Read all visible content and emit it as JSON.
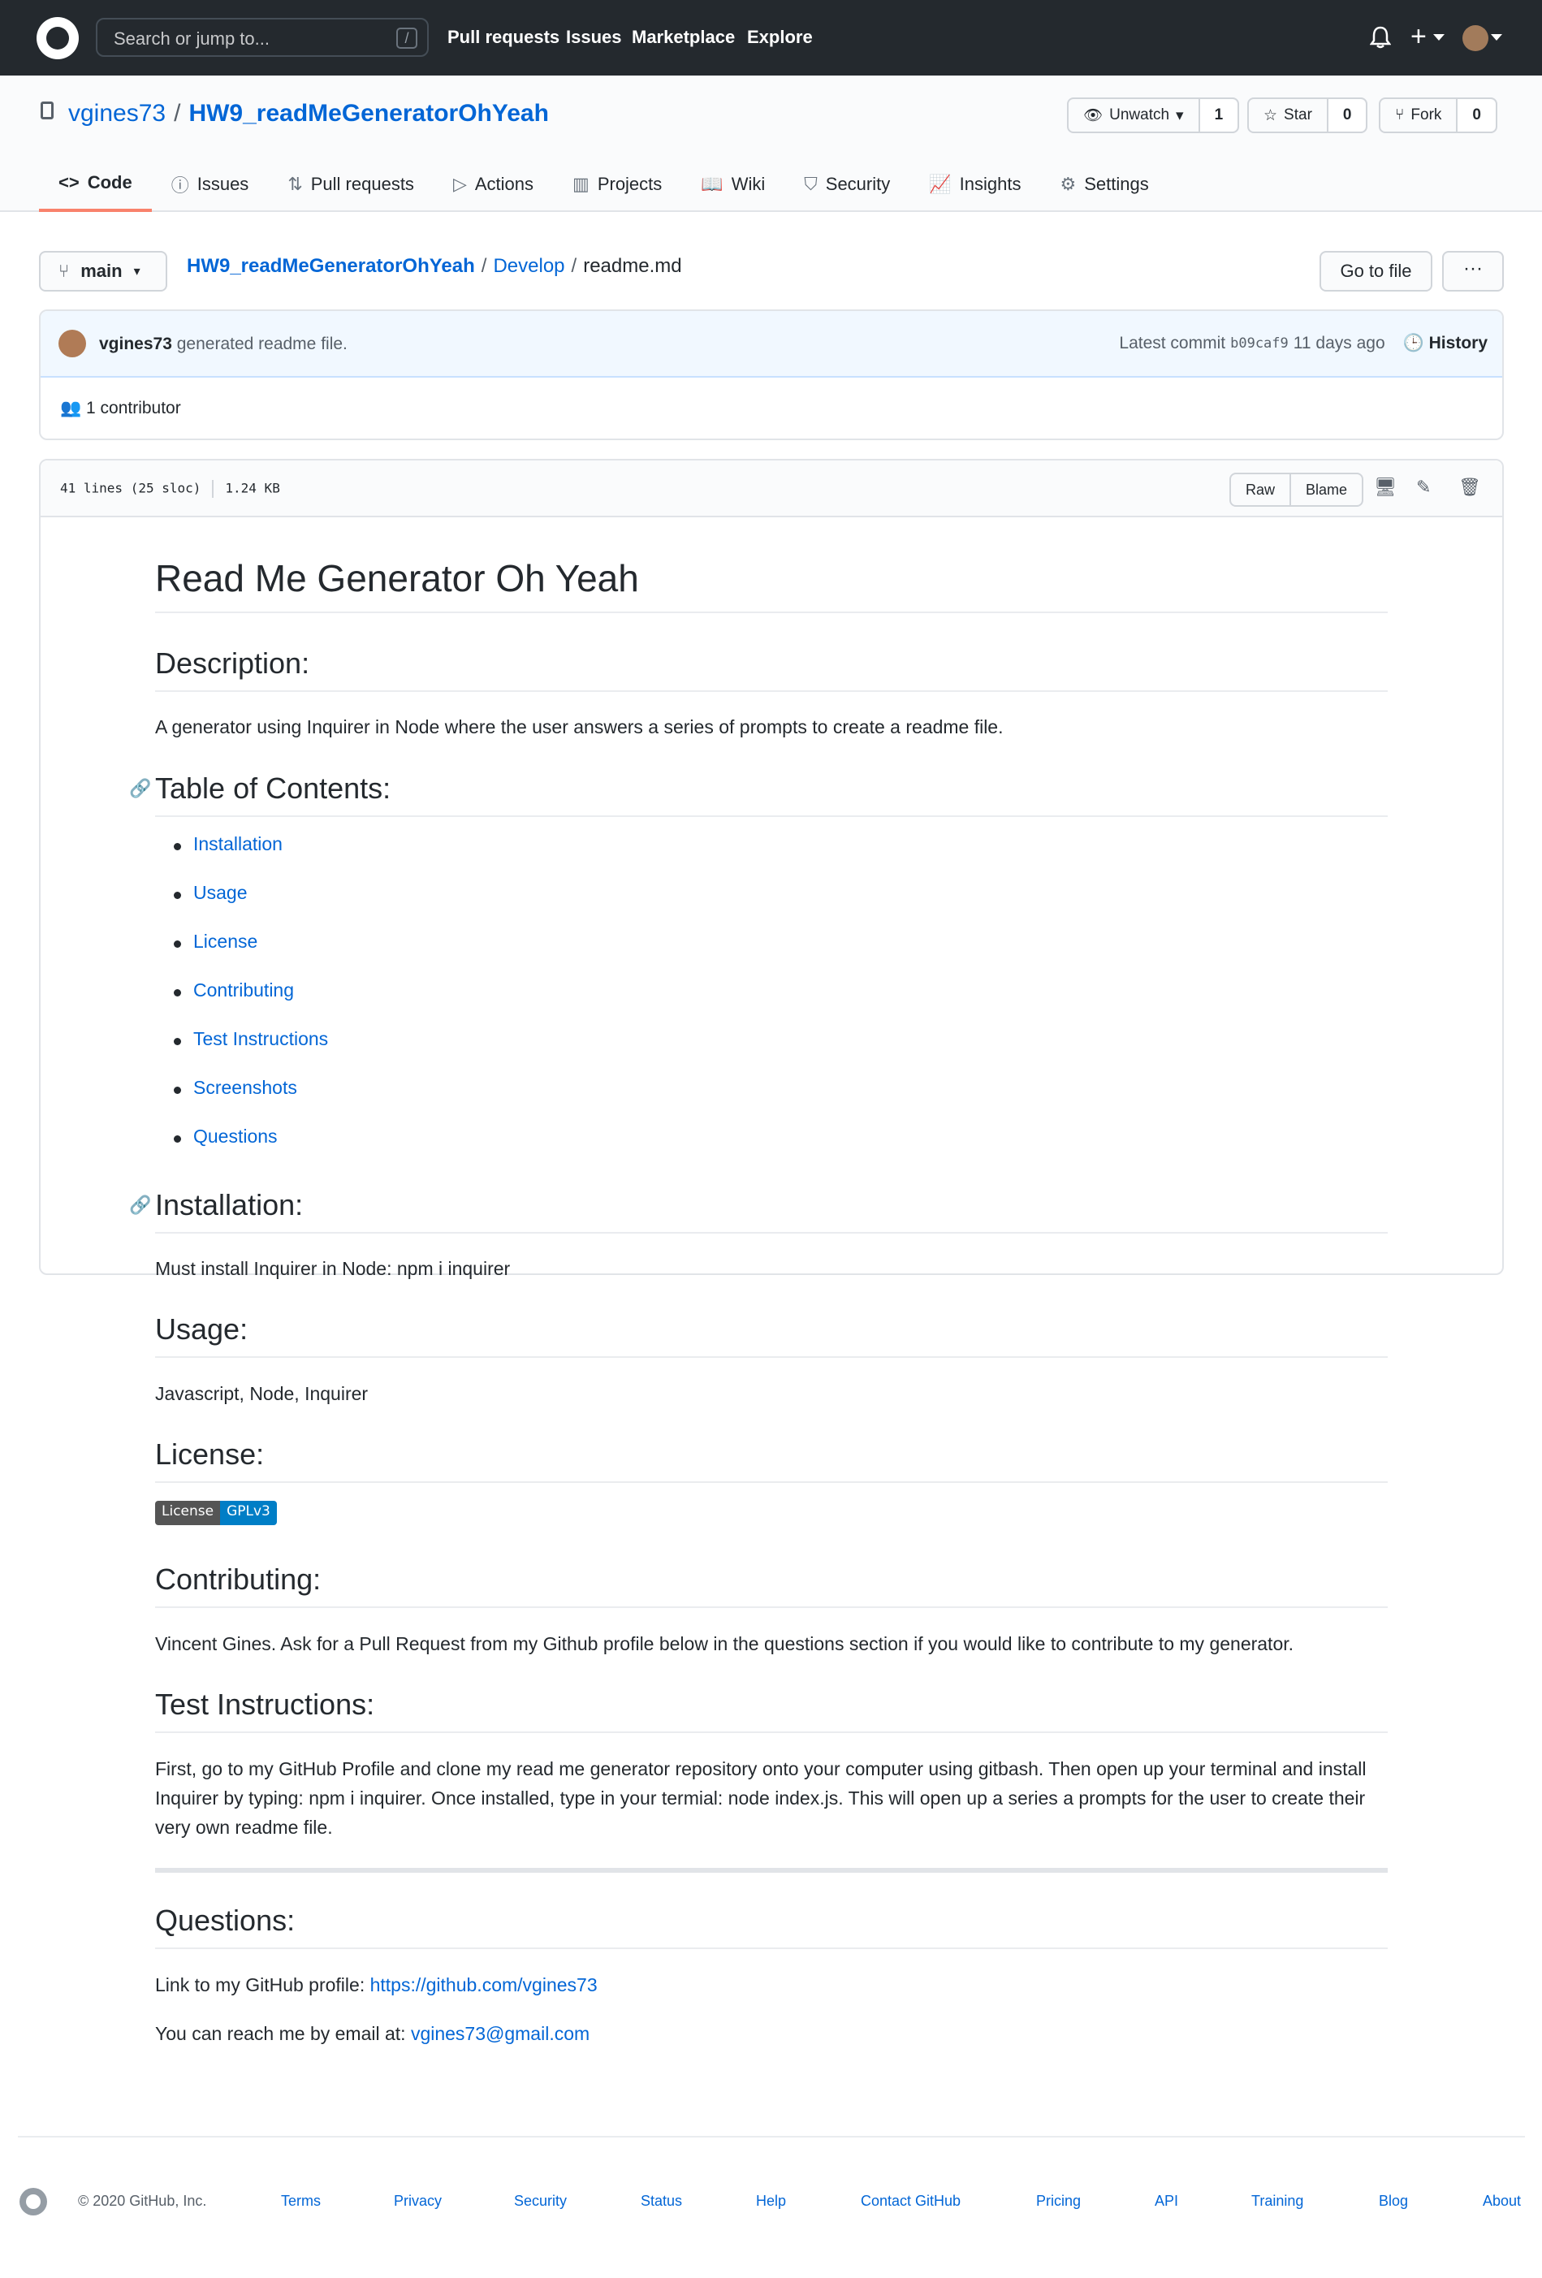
{
  "header": {
    "search_placeholder": "Search or jump to...",
    "search_shortcut": "/",
    "nav": [
      "Pull requests",
      "Issues",
      "Marketplace",
      "Explore"
    ],
    "plus_label": "+"
  },
  "repo": {
    "owner": "vgines73",
    "separator": "/",
    "name": "HW9_readMeGeneratorOhYeah",
    "watch": {
      "label": "Unwatch",
      "count": "1"
    },
    "star": {
      "label": "Star",
      "count": "0"
    },
    "fork": {
      "label": "Fork",
      "count": "0"
    },
    "tabs": [
      {
        "label": "Code",
        "icon": "code-icon"
      },
      {
        "label": "Issues",
        "icon": "issue-icon"
      },
      {
        "label": "Pull requests",
        "icon": "pull-request-icon"
      },
      {
        "label": "Actions",
        "icon": "play-icon"
      },
      {
        "label": "Projects",
        "icon": "project-icon"
      },
      {
        "label": "Wiki",
        "icon": "book-icon"
      },
      {
        "label": "Security",
        "icon": "shield-icon"
      },
      {
        "label": "Insights",
        "icon": "graph-icon"
      },
      {
        "label": "Settings",
        "icon": "gear-icon"
      }
    ]
  },
  "breadcrumb": {
    "branch": "main",
    "repo": "HW9_readMeGeneratorOhYeah",
    "folder": "Develop",
    "file": "readme.md",
    "sep": "/",
    "go_to_file": "Go to file",
    "more": "···"
  },
  "commit": {
    "author": "vgines73",
    "message": "generated readme file.",
    "latest_label": "Latest commit",
    "sha": "b09caf9",
    "age": "11 days ago",
    "history": "History",
    "contributors": "1 contributor"
  },
  "file": {
    "lines": "41 lines (25 sloc)",
    "size": "1.24 KB",
    "raw": "Raw",
    "blame": "Blame"
  },
  "readme": {
    "title": "Read Me Generator Oh Yeah",
    "description_heading": "Description:",
    "description": "A generator using Inquirer in Node where the user answers a series of prompts to create a readme file.",
    "toc_heading": "Table of Contents:",
    "toc": [
      "Installation",
      "Usage",
      "License",
      "Contributing",
      "Test Instructions",
      "Screenshots",
      "Questions"
    ],
    "installation_heading": "Installation:",
    "installation": "Must install Inquirer in Node: npm i inquirer",
    "usage_heading": "Usage:",
    "usage": "Javascript, Node, Inquirer",
    "license_heading": "License:",
    "badge_left": "License",
    "badge_right": "GPLv3",
    "contributing_heading": "Contributing:",
    "contributing": "Vincent Gines. Ask for a Pull Request from my Github profile below in the questions section if you would like to contribute to my generator.",
    "test_heading": "Test Instructions:",
    "test": "First, go to my GitHub Profile and clone my read me generator repository onto your computer using gitbash. Then open up your terminal and install Inquirer by typing: npm i inquirer. Once installed, type in your termial: node index.js. This will open up a series a prompts for the user to create their very own readme file.",
    "questions_heading": "Questions:",
    "profile_label": "Link to my GitHub profile: ",
    "profile_url": "https://github.com/vgines73",
    "email_label": "You can reach me by email at: ",
    "email": "vgines73@gmail.com"
  },
  "footer": {
    "copyright": "© 2020 GitHub, Inc.",
    "links": [
      "Terms",
      "Privacy",
      "Security",
      "Status",
      "Help",
      "Contact GitHub",
      "Pricing",
      "API",
      "Training",
      "Blog",
      "About"
    ]
  }
}
